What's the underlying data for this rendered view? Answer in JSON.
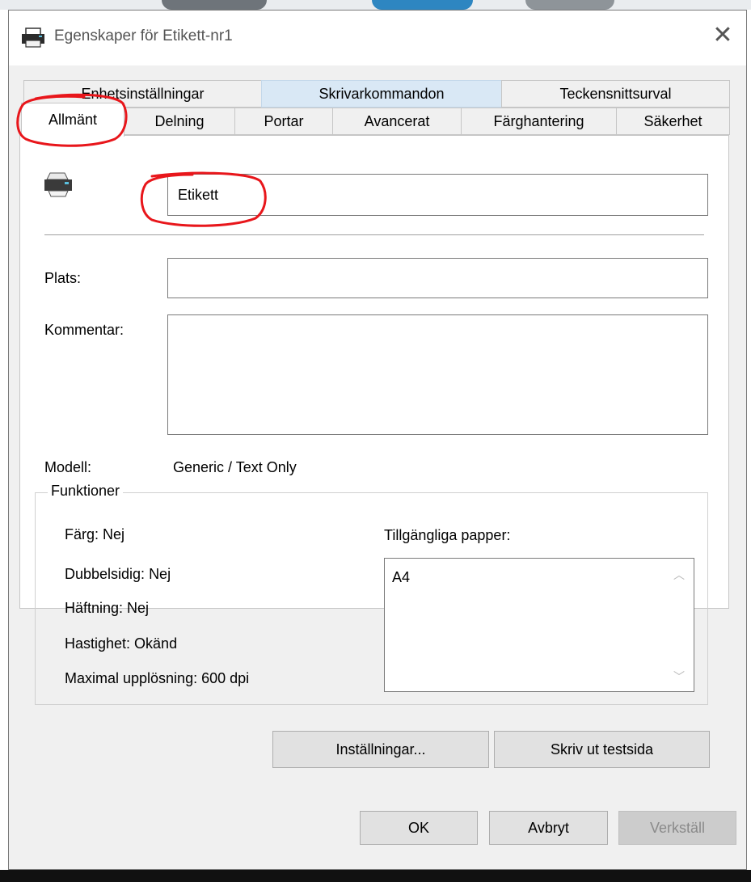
{
  "window": {
    "title": "Egenskaper för Etikett-nr1",
    "close_icon": "close-icon"
  },
  "tabs": {
    "row_top": [
      "Enhetsinställningar",
      "Skrivarkommandon",
      "Teckensnittsurval"
    ],
    "row_bottom": [
      "Allmänt",
      "Delning",
      "Portar",
      "Avancerat",
      "Färghantering",
      "Säkerhet"
    ],
    "active": "Allmänt"
  },
  "general": {
    "printer_name": "Etikett",
    "location_label": "Plats:",
    "location_value": "",
    "comment_label": "Kommentar:",
    "comment_value": "",
    "model_label": "Modell:",
    "model_value": "Generic / Text Only"
  },
  "features": {
    "group_title": "Funktioner",
    "color": "Färg: Nej",
    "duplex": "Dubbelsidig: Nej",
    "stapling": "Häftning: Nej",
    "speed": "Hastighet: Okänd",
    "max_resolution": "Maximal upplösning: 600 dpi",
    "paper_label": "Tillgängliga papper:",
    "papers": [
      "A4"
    ]
  },
  "buttons": {
    "preferences": "Inställningar...",
    "print_test": "Skriv ut testsida",
    "ok": "OK",
    "cancel": "Avbryt",
    "apply": "Verkställ"
  },
  "colors": {
    "annotation_red": "#e8161b",
    "highlight_tab": "#d9e8f5"
  }
}
